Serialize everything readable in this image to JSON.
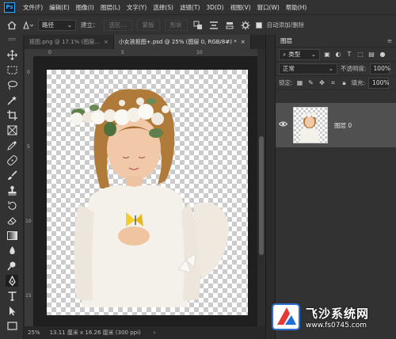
{
  "app": {
    "logo": "Ps"
  },
  "menu": [
    "文件(F)",
    "编辑(E)",
    "图像(I)",
    "图层(L)",
    "文字(Y)",
    "选择(S)",
    "滤镜(T)",
    "3D(D)",
    "视图(V)",
    "窗口(W)",
    "帮助(H)"
  ],
  "options": {
    "mode_select": "路径",
    "build_label": "建立：",
    "selection_btn": "选区...",
    "mask_btn": "蒙版",
    "shape_btn": "形状",
    "auto_add_label": "自动添加/删除"
  },
  "tabs": [
    {
      "label": "抠图.png @ 17.1% (图层...",
      "active": false
    },
    {
      "label": "小女孩抠图+.psd @ 25% (图层 0, RGB/8#) *",
      "active": true
    }
  ],
  "ruler": {
    "h_ticks": [
      "0",
      "5",
      "10"
    ],
    "v_ticks": [
      "0",
      "5",
      "10",
      "15"
    ]
  },
  "status": {
    "zoom": "25%",
    "doc_info": "13.11 厘米 x 16.26 厘米 (300 ppi)"
  },
  "layers_panel": {
    "title": "图层",
    "filter_kind": "类型",
    "blend_mode": "正常",
    "opacity_label": "不透明度:",
    "opacity_value": "100%",
    "lock_label": "锁定:",
    "fill_label": "填充:",
    "fill_value": "100%",
    "layers": [
      {
        "name": "图层 0",
        "visible": true
      }
    ]
  },
  "watermark": {
    "title": "飞沙系统网",
    "url": "www.fs0745.com"
  },
  "colors": {
    "accent": "#31a8ff",
    "panel": "#323232",
    "canvas_bg": "#1f1f1f"
  }
}
